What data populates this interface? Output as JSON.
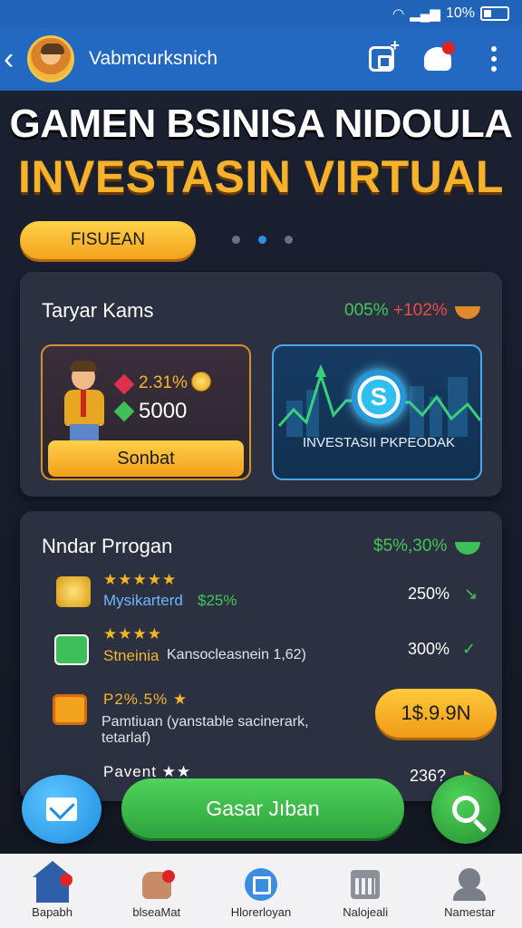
{
  "status_bar": {
    "battery": "10%"
  },
  "app_bar": {
    "title": "Vabmcurksnich"
  },
  "hero": {
    "line1": "GAMEN BSINISA NIDOULA",
    "line2": "INVESTASIN VIRTUAL",
    "pill_button": "FISUEAN",
    "pager_active_index": 1
  },
  "card1": {
    "title": "Taryar Kams",
    "stat_green": "005%",
    "stat_red": "+102%",
    "tile_char": {
      "rate": "2.31%",
      "amount": "5000",
      "button": "Sonbat"
    },
    "tile_invest": {
      "label": "INVESTASII PKPEODAK",
      "coin_symbol": "S"
    }
  },
  "card2": {
    "title": "Nndar Prrogan",
    "stat": "$5%,30%",
    "rows": [
      {
        "stars": "★★★★★",
        "name": "Mysikarterd",
        "value": "$25%",
        "pct": "250%",
        "arrow": "↘"
      },
      {
        "stars": "★★★★",
        "name": "Stneinia",
        "value": "Kansocleasnein 1,62)",
        "pct": "300%",
        "arrow": "✓"
      },
      {
        "stars": "P2%.5% ★",
        "name": "Pamtiuan (yanstable sacinerark,",
        "value": "tetarlaf)",
        "pct": "",
        "arrow": ""
      },
      {
        "stars": "Pavent ★★",
        "name": "",
        "value": "",
        "pct": "236?",
        "arrow": "▶"
      }
    ],
    "price_button": "1$.9.9N"
  },
  "main_button": "Gasar Jıban",
  "bottom_nav": [
    {
      "label": "Bapabh",
      "icon": "home-icon"
    },
    {
      "label": "blseaMat",
      "icon": "hands-icon"
    },
    {
      "label": "Hlorerloyan",
      "icon": "search-doc-icon"
    },
    {
      "label": "Nalojeali",
      "icon": "calendar-icon"
    },
    {
      "label": "Namestar",
      "icon": "profile-icon"
    }
  ],
  "colors": {
    "status_bar": "#1f64b8",
    "app_bar": "#2369c2",
    "background": "#1c2233",
    "accent_gold": "#f7b22c",
    "accent_green": "#43c65a",
    "accent_blue": "#2f8fe4"
  }
}
